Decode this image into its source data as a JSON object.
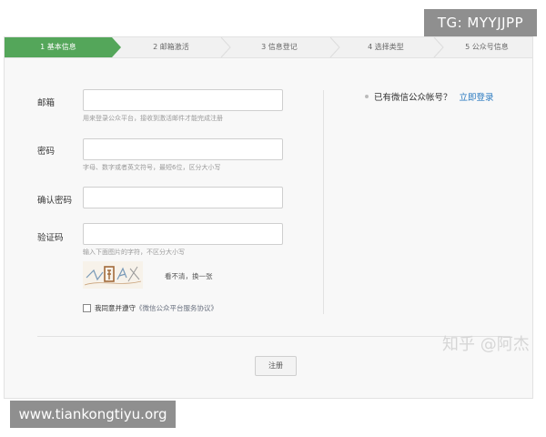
{
  "tag": "TG: MYYJJPP",
  "steps": [
    {
      "label": "1 基本信息",
      "active": true
    },
    {
      "label": "2 邮箱激活",
      "active": false
    },
    {
      "label": "3 信息登记",
      "active": false
    },
    {
      "label": "4 选择类型",
      "active": false
    },
    {
      "label": "5 公众号信息",
      "active": false
    }
  ],
  "form": {
    "email": {
      "label": "邮箱",
      "value": "",
      "hint": "用来登录公众平台，接收到激活邮件才能完成注册"
    },
    "password": {
      "label": "密码",
      "value": "",
      "hint": "字母、数字或者英文符号，最短6位，区分大小写"
    },
    "confirm": {
      "label": "确认密码",
      "value": ""
    },
    "captcha": {
      "label": "验证码",
      "value": "",
      "hint": "输入下面图片的字符，不区分大小写",
      "refresh": "看不清，换一张"
    },
    "agree_text": "我同意并遵守",
    "agree_link": "《微信公众平台服务协议》",
    "register": "注册"
  },
  "side": {
    "have_account": "已有微信公众帐号？",
    "login": "立即登录"
  },
  "colors": {
    "active_step": "#54a65a",
    "link": "#2a7ac0"
  },
  "watermark": "知乎 @阿杰",
  "url": "www.tiankongtiyu.org"
}
